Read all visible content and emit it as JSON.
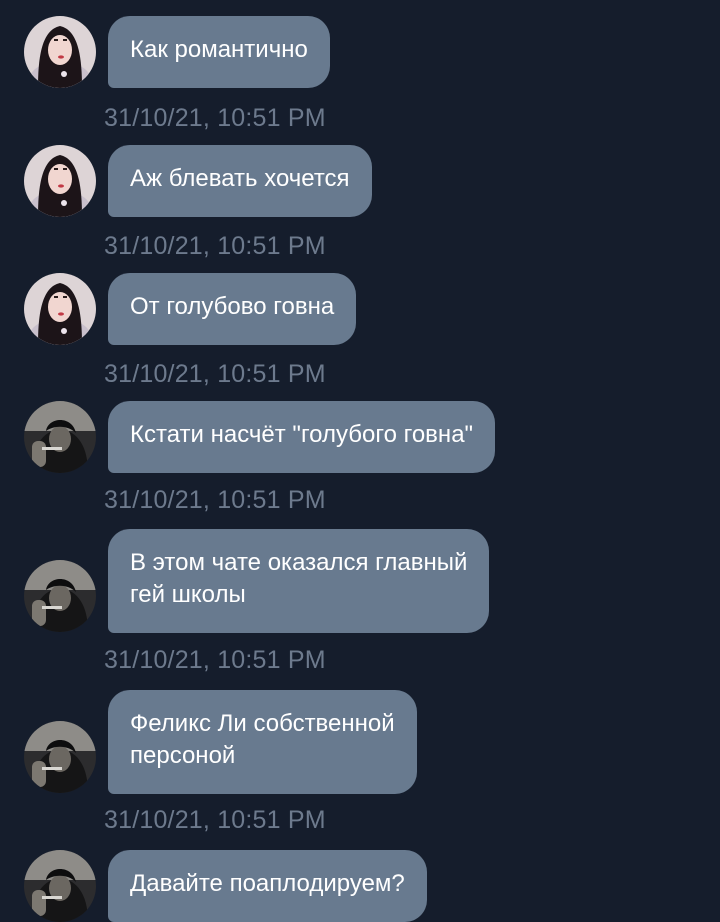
{
  "messages": [
    {
      "text": "Как романтично",
      "time": "31/10/21, 10:51 PM",
      "avatar": "girl-avatar"
    },
    {
      "text": "Аж блевать хочется",
      "time": "31/10/21, 10:51 PM",
      "avatar": "girl-avatar"
    },
    {
      "text": "От голубово говна",
      "time": "31/10/21, 10:51 PM",
      "avatar": "girl-avatar"
    },
    {
      "text": "Кстати насчёт \"голубого говна\"",
      "time": "31/10/21, 10:51 PM",
      "avatar": "boy-avatar"
    },
    {
      "text": "В этом чате оказался главный\nгей школы",
      "time": "31/10/21, 10:51 PM",
      "avatar": "boy-avatar"
    },
    {
      "text": "Феликс Ли собственной\nперсоной",
      "time": "31/10/21, 10:51 PM",
      "avatar": "boy-avatar"
    },
    {
      "text": "Давайте поаплодируем?",
      "time": "",
      "avatar": "boy-avatar"
    }
  ],
  "colors": {
    "background": "#151d2c",
    "bubble": "#687a8f",
    "timestamp": "#6d7a8d"
  }
}
